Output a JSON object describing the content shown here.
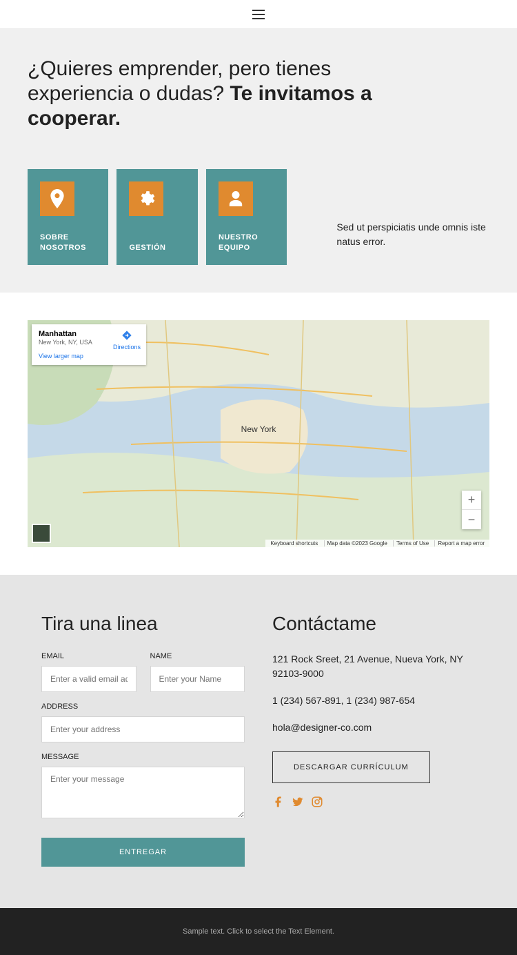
{
  "hero": {
    "title_light": "¿Quieres emprender, pero tienes experiencia o dudas? ",
    "title_bold": "Te invitamos a cooperar."
  },
  "cards": [
    {
      "label": "SOBRE NOSOTROS",
      "icon": "pin-icon"
    },
    {
      "label": "GESTIÓN",
      "icon": "gear-icon"
    },
    {
      "label": "NUESTRO EQUIPO",
      "icon": "user-icon"
    }
  ],
  "side_text": "Sed ut perspiciatis unde omnis iste natus error.",
  "map": {
    "title": "Manhattan",
    "subtitle": "New York, NY, USA",
    "directions_label": "Directions",
    "larger_map_link": "View larger map",
    "center_label": "New York",
    "attrib": {
      "shortcuts": "Keyboard shortcuts",
      "data": "Map data ©2023 Google",
      "terms": "Terms of Use",
      "report": "Report a map error"
    }
  },
  "form": {
    "heading": "Tira una linea",
    "email_label": "EMAIL",
    "email_placeholder": "Enter a valid email address",
    "name_label": "NAME",
    "name_placeholder": "Enter your Name",
    "address_label": "ADDRESS",
    "address_placeholder": "Enter your address",
    "message_label": "MESSAGE",
    "message_placeholder": "Enter your message",
    "submit_label": "ENTREGAR"
  },
  "contact": {
    "heading": "Contáctame",
    "address": "121 Rock Sreet, 21 Avenue, Nueva York, NY 92103-9000",
    "phone": "1 (234) 567-891, 1 (234) 987-654",
    "email": "hola@designer-co.com",
    "download_label": "DESCARGAR CURRÍCULUM"
  },
  "footer": {
    "text": "Sample text. Click to select the Text Element."
  }
}
